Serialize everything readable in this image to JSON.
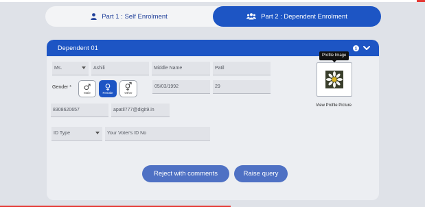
{
  "tabs": {
    "part1_label": "Part 1 : Self Enrolment",
    "part2_label": "Part 2 : Dependent Enrolment",
    "part1_icon": "user-icon",
    "part2_icon": "users-group-icon",
    "active": "part2"
  },
  "panel": {
    "title": "Dependent 01",
    "info_icon": "i",
    "header_color": "#1d55c4"
  },
  "form": {
    "salutation": "Ms.",
    "first_name": "Ashili",
    "middle_name_placeholder": "Middle Name",
    "last_name": "Patil",
    "gender_label": "Gender *",
    "gender_options": [
      {
        "symbol": "♂",
        "label": "Male"
      },
      {
        "symbol": "♀",
        "label": "Female"
      },
      {
        "symbol": "⚥",
        "label": "Other"
      }
    ],
    "gender_selected": "Female",
    "dob": "05/03/1992",
    "age": "29",
    "phone": "8308620657",
    "email": "apatil777@digit9.in",
    "id_type_placeholder": "ID Type",
    "id_number_placeholder": "Your Voter's ID No"
  },
  "profile": {
    "tooltip": "Profile Image",
    "view_label": "View Profile Picture"
  },
  "actions": {
    "reject_label": "Reject with comments",
    "query_label": "Raise query"
  }
}
